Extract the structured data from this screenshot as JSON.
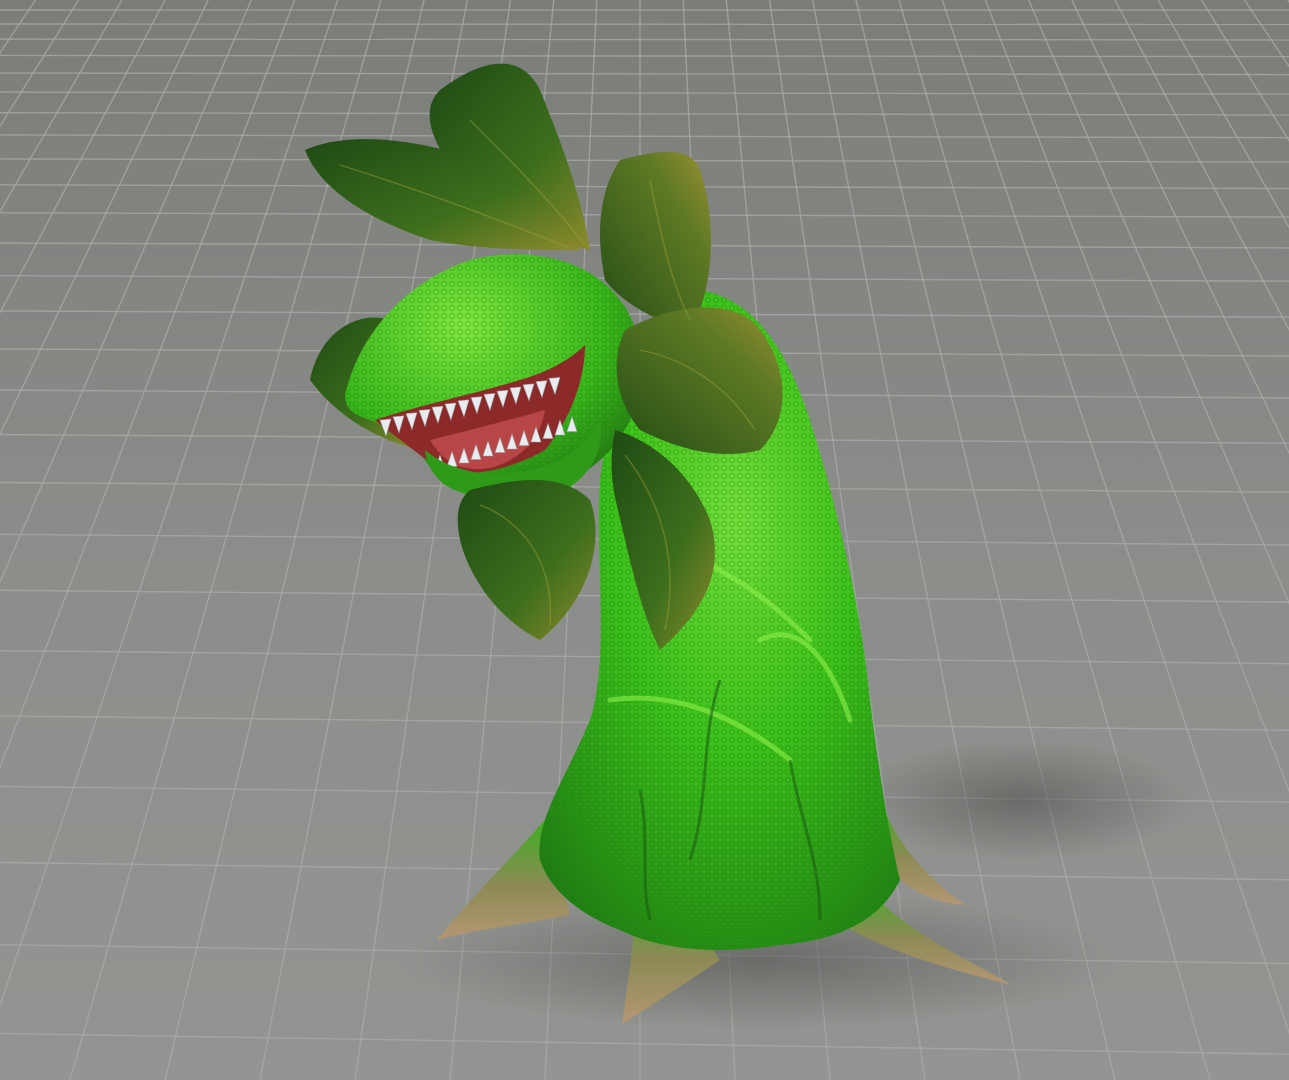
{
  "scene": {
    "subject": "carnivorous-plant-creature-3d-render",
    "colors": {
      "floor": "#8b8d8a",
      "floor_dark": "#747672",
      "grid": "#a6a8a5",
      "body": "#3cc31a",
      "body_light": "#7be83c",
      "body_dark": "#1d7a0e",
      "leaf": "#2f5f1b",
      "leaf_light": "#8a8a2a",
      "root": "#a78a62",
      "mouth": "#8c2a2a",
      "teeth": "#e9ecee"
    }
  }
}
